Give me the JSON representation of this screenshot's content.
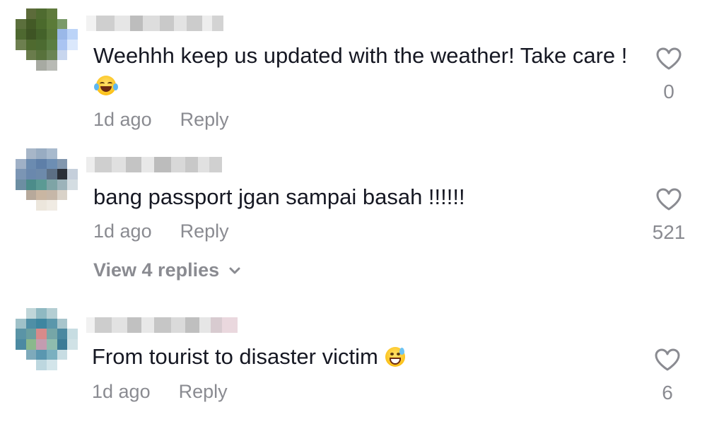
{
  "comments": [
    {
      "text": "Weehhh keep us updated with the weather! Take care !",
      "emoji": "joy-tears",
      "time": "1d ago",
      "reply_label": "Reply",
      "likes": "0"
    },
    {
      "text": "bang passport jgan sampai basah !!!!!!",
      "time": "1d ago",
      "reply_label": "Reply",
      "likes": "521",
      "view_replies": "View 4 replies"
    },
    {
      "text": "From tourist to disaster victim",
      "emoji": "grinning-sweat",
      "time": "1d ago",
      "reply_label": "Reply",
      "likes": "6"
    }
  ],
  "colors": {
    "text": "#161823",
    "secondary": "#8a8b91",
    "background": "#ffffff"
  }
}
